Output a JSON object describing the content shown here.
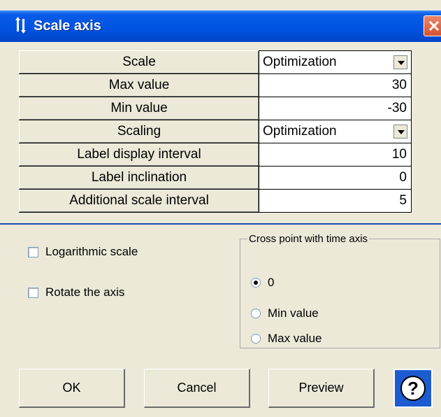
{
  "window": {
    "title": "Scale axis"
  },
  "grid": {
    "rows": [
      {
        "label": "Scale",
        "value": "Optimization",
        "type": "dropdown"
      },
      {
        "label": "Max value",
        "value": "30",
        "type": "text"
      },
      {
        "label": "Min value",
        "value": "-30",
        "type": "text"
      },
      {
        "label": "Scaling",
        "value": "Optimization",
        "type": "dropdown"
      },
      {
        "label": "Label display interval",
        "value": "10",
        "type": "text"
      },
      {
        "label": "Label inclination",
        "value": "0",
        "type": "text"
      },
      {
        "label": "Additional scale interval",
        "value": "5",
        "type": "text"
      }
    ]
  },
  "options": {
    "logarithmic_label": "Logarithmic scale",
    "logarithmic_checked": false,
    "rotate_label": "Rotate the axis",
    "rotate_checked": false
  },
  "cross_point": {
    "legend": "Cross point with time axis",
    "options": [
      "0",
      "Min value",
      "Max value"
    ],
    "selected": "0"
  },
  "buttons": {
    "ok": "OK",
    "cancel": "Cancel",
    "preview": "Preview"
  },
  "icons": {
    "title": "axis-arrows-icon",
    "close": "close-icon",
    "help": "help-icon"
  },
  "colors": {
    "titlebar": "#0054e3",
    "separator": "#1a4bb3",
    "close": "#d3542f"
  }
}
